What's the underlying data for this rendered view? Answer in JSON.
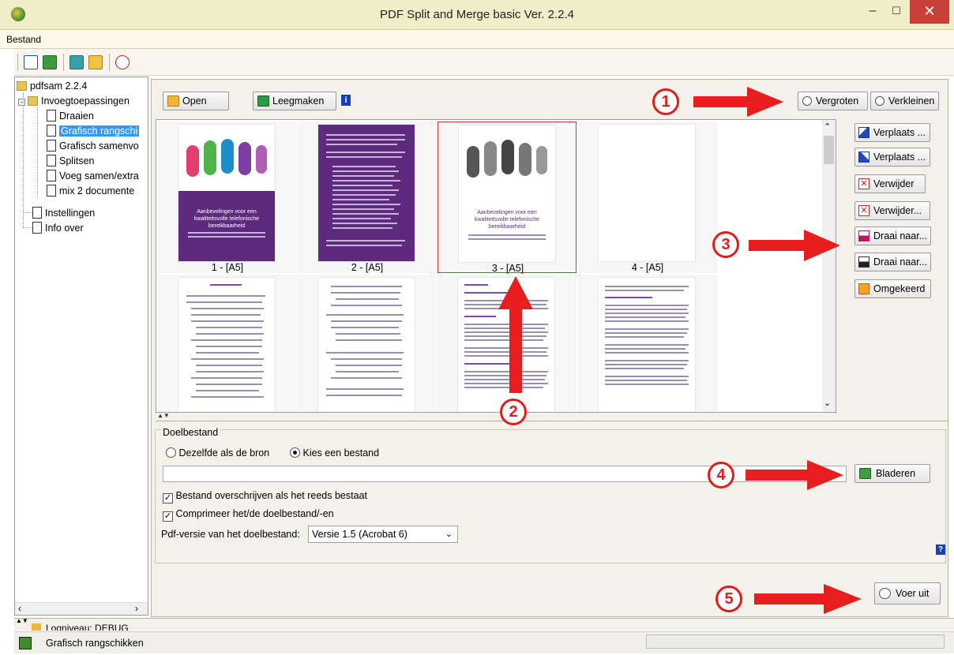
{
  "window": {
    "title": "PDF Split and Merge basic Ver. 2.2.4"
  },
  "menu": {
    "bestand": "Bestand"
  },
  "tree": {
    "root": "pdfsam 2.2.4",
    "group": "Invoegtoepassingen",
    "items": [
      "Draaien",
      "Grafisch rangschi",
      "Grafisch samenvo",
      "Splitsen",
      "Voeg samen/extra",
      "mix 2 documente"
    ],
    "settings": "Instellingen",
    "about": "Info over"
  },
  "toolbar": {
    "open": "Open",
    "clear": "Leegmaken",
    "zoom_in": "Vergroten",
    "zoom_out": "Verkleinen"
  },
  "pages": [
    {
      "caption": "1 - [A5]",
      "cover_title": "Aanbevelingen voor een kwaliteitsvolle telefonische bereikbaarheid"
    },
    {
      "caption": "2 - [A5]"
    },
    {
      "caption": "3 - [A5]",
      "cover_title": "Aanbevelingen voor een kwaliteitsvolle telefonische bereikbaarheid"
    },
    {
      "caption": "4 - [A5]"
    }
  ],
  "side_buttons": {
    "move_up": "Verplaats ...",
    "move_down": "Verplaats ...",
    "remove": "Verwijder",
    "remove_more": "Verwijder...",
    "rotate_right": "Draai naar...",
    "rotate_left": "Draai naar...",
    "reverse": "Omgekeerd"
  },
  "target": {
    "legend": "Doelbestand",
    "radio_same": "Dezelfde als de bron",
    "radio_choose": "Kies een bestand",
    "path_value": "",
    "browse": "Bladeren",
    "overwrite": "Bestand overschrijven als het reeds bestaat",
    "compress": "Comprimeer het/de doelbestand/-en",
    "version_label": "Pdf-versie van het doelbestand:",
    "version_value": "Versie 1.5 (Acrobat 6)",
    "help": "?"
  },
  "run": "Voer uit",
  "log": "Logniveau: DEBUG",
  "status": "Grafisch rangschikken",
  "annotations": [
    "1",
    "2",
    "3",
    "4",
    "5"
  ],
  "colors": {
    "accent_red": "#e81e1e",
    "selection": "#3399ff",
    "purple_cover": "#5e2a7e"
  }
}
